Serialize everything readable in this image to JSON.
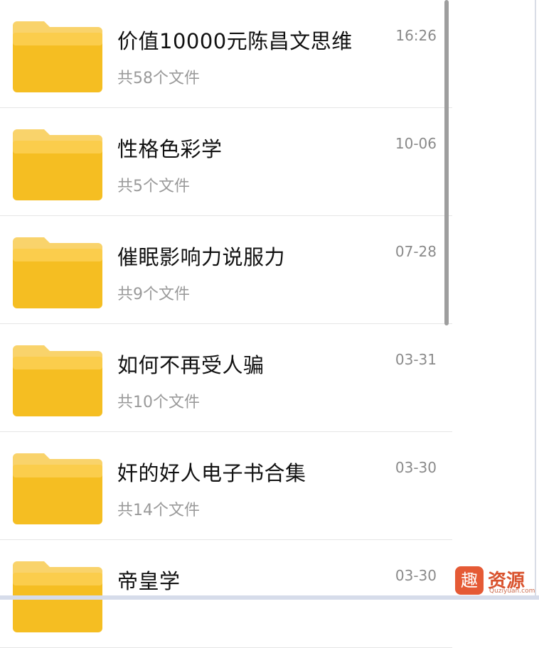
{
  "folders": [
    {
      "title": "价值10000元陈昌文思维",
      "subtitle": "共58个文件",
      "time": "16:26"
    },
    {
      "title": "性格色彩学",
      "subtitle": "共5个文件",
      "time": "10-06"
    },
    {
      "title": "催眠影响力说服力",
      "subtitle": "共9个文件",
      "time": "07-28"
    },
    {
      "title": "如何不再受人骗",
      "subtitle": "共10个文件",
      "time": "03-31"
    },
    {
      "title": "奸的好人电子书合集",
      "subtitle": "共14个文件",
      "time": "03-30"
    },
    {
      "title": "帝皇学",
      "subtitle": "",
      "time": "03-30"
    }
  ],
  "icons": {
    "folder": "folder-icon"
  },
  "watermark": {
    "glyph": "趣",
    "text": "资源",
    "url": "Quziyuan.com"
  }
}
